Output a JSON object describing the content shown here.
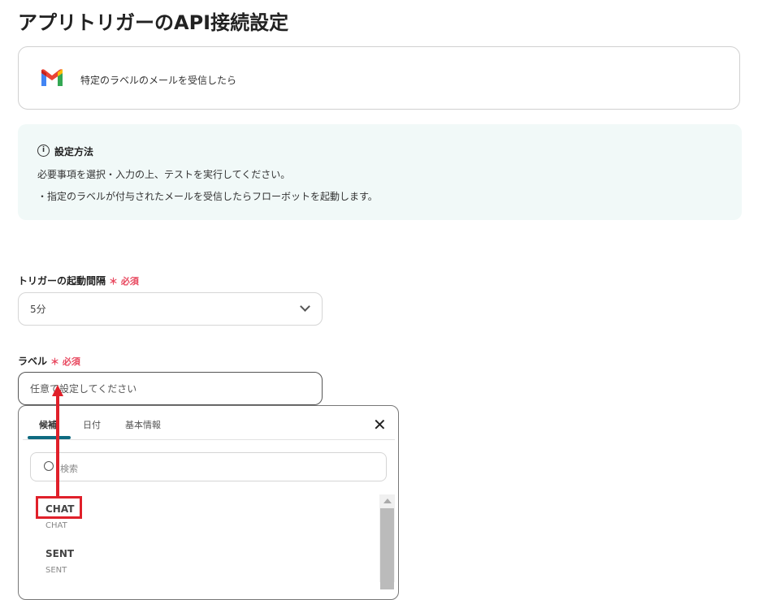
{
  "page_title": "アプリトリガーのAPI接続設定",
  "trigger_card": {
    "icon": "gmail-icon",
    "text": "特定のラベルのメールを受信したら"
  },
  "info": {
    "title": "設定方法",
    "lines": [
      "必要事項を選択・入力の上、テストを実行してください。",
      "・指定のラベルが付与されたメールを受信したらフローボットを起動します。"
    ]
  },
  "interval": {
    "label": "トリガーの起動間隔",
    "required": "＊ 必須",
    "value": "5分"
  },
  "label_field": {
    "label": "ラベル",
    "required": "＊ 必須",
    "placeholder": "任意で設定してください"
  },
  "dropdown": {
    "tabs": [
      "候補",
      "日付",
      "基本情報"
    ],
    "search_placeholder": "検索",
    "items": [
      {
        "name": "CHAT",
        "sub": "CHAT"
      },
      {
        "name": "SENT",
        "sub": "SENT"
      }
    ]
  },
  "colors": {
    "accent": "#0f6a80",
    "annotation": "#e0202a",
    "required": "#e8475e"
  }
}
